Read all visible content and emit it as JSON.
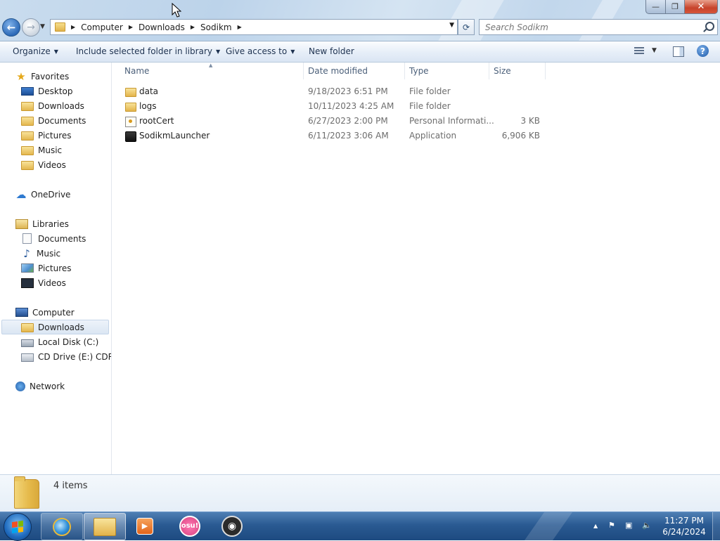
{
  "window": {
    "minimize_glyph": "—",
    "maximize_glyph": "❐",
    "close_glyph": "✕"
  },
  "address": {
    "breadcrumbs": [
      "Computer",
      "Downloads",
      "Sodikm"
    ],
    "separator_glyph": "▶",
    "dropdown_glyph": "▼",
    "refresh_glyph": "⟳"
  },
  "search": {
    "placeholder": "Search Sodikm"
  },
  "toolbar": {
    "organize": "Organize",
    "include_in_library": "Include selected folder in library",
    "give_access": "Give access to",
    "new_folder": "New folder",
    "help_glyph": "?"
  },
  "nav_pane": {
    "favorites_label": "Favorites",
    "favorites": [
      {
        "label": "Desktop",
        "icon": "desktop-icon"
      },
      {
        "label": "Downloads",
        "icon": "downloads-folder-icon"
      },
      {
        "label": "Documents",
        "icon": "documents-folder-icon"
      },
      {
        "label": "Pictures",
        "icon": "pictures-folder-icon"
      },
      {
        "label": "Music",
        "icon": "music-folder-icon"
      },
      {
        "label": "Videos",
        "icon": "videos-folder-icon"
      }
    ],
    "onedrive_label": "OneDrive",
    "libraries_label": "Libraries",
    "libraries": [
      {
        "label": "Documents",
        "icon": "documents-library-icon"
      },
      {
        "label": "Music",
        "icon": "music-library-icon"
      },
      {
        "label": "Pictures",
        "icon": "pictures-library-icon"
      },
      {
        "label": "Videos",
        "icon": "videos-library-icon"
      }
    ],
    "computer_label": "Computer",
    "computer_items": [
      {
        "label": "Downloads",
        "icon": "downloads-folder-icon",
        "selected": true
      },
      {
        "label": "Local Disk (C:)",
        "icon": "hard-disk-icon"
      },
      {
        "label": "CD Drive (E:) CDROM",
        "icon": "cd-drive-icon"
      }
    ],
    "network_label": "Network"
  },
  "columns": {
    "name": "Name",
    "date_modified": "Date modified",
    "type": "Type",
    "size": "Size",
    "sort_glyph": "▲"
  },
  "files": [
    {
      "name": "data",
      "date": "9/18/2023 6:51 PM",
      "type": "File folder",
      "size": "",
      "icon": "folder-icon"
    },
    {
      "name": "logs",
      "date": "10/11/2023 4:25 AM",
      "type": "File folder",
      "size": "",
      "icon": "folder-icon"
    },
    {
      "name": "rootCert",
      "date": "6/27/2023 2:00 PM",
      "type": "Personal Informati...",
      "size": "3 KB",
      "icon": "certificate-icon"
    },
    {
      "name": "SodikmLauncher",
      "date": "6/11/2023 3:06 AM",
      "type": "Application",
      "size": "6,906 KB",
      "icon": "application-icon"
    }
  ],
  "details": {
    "item_count": "4 items"
  },
  "taskbar": {
    "apps": [
      {
        "name": "internet-explorer",
        "state": "open"
      },
      {
        "name": "windows-explorer",
        "state": "active"
      },
      {
        "name": "media-player",
        "state": "pinned"
      },
      {
        "name": "osu",
        "state": "pinned",
        "label": "osu!"
      },
      {
        "name": "obs-studio",
        "state": "pinned"
      }
    ],
    "tray_expand_glyph": "▲",
    "clock_time": "11:27 PM",
    "clock_date": "6/24/2024"
  },
  "colors": {
    "accent": "#2a5a92",
    "selection": "#dbe6f3",
    "secondary_text": "#6d6d6d"
  }
}
